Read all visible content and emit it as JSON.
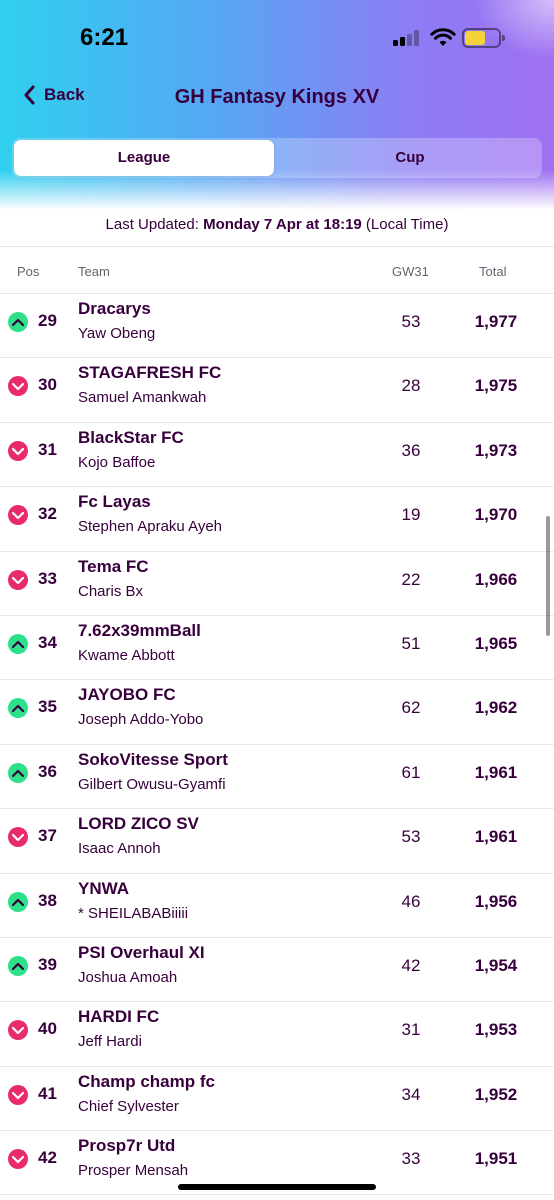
{
  "status_bar": {
    "time": "6:21"
  },
  "nav": {
    "back_label": "Back",
    "title": "GH Fantasy Kings XV"
  },
  "tabs": [
    {
      "label": "League"
    },
    {
      "label": "Cup"
    }
  ],
  "updated": {
    "prefix": "Last Updated: ",
    "date": "Monday 7 Apr at 18:19",
    "suffix": " (Local Time)"
  },
  "table": {
    "headers": {
      "pos": "Pos",
      "team": "Team",
      "gw": "GW31",
      "total": "Total"
    },
    "rows": [
      {
        "movement": "up",
        "pos": "29",
        "team": "Dracarys",
        "manager": "Yaw Obeng",
        "gw": "53",
        "total": "1,977"
      },
      {
        "movement": "down",
        "pos": "30",
        "team": "STAGAFRESH FC",
        "manager": "Samuel Amankwah",
        "gw": "28",
        "total": "1,975"
      },
      {
        "movement": "down",
        "pos": "31",
        "team": "BlackStar FC",
        "manager": "Kojo Baffoe",
        "gw": "36",
        "total": "1,973"
      },
      {
        "movement": "down",
        "pos": "32",
        "team": "Fc Layas",
        "manager": "Stephen Apraku Ayeh",
        "gw": "19",
        "total": "1,970"
      },
      {
        "movement": "down",
        "pos": "33",
        "team": "Tema FC",
        "manager": "Charis Bx",
        "gw": "22",
        "total": "1,966"
      },
      {
        "movement": "up",
        "pos": "34",
        "team": "7.62x39mmBall",
        "manager": "Kwame Abbott",
        "gw": "51",
        "total": "1,965"
      },
      {
        "movement": "up",
        "pos": "35",
        "team": "JAYOBO FC",
        "manager": "Joseph Addo-Yobo",
        "gw": "62",
        "total": "1,962"
      },
      {
        "movement": "up",
        "pos": "36",
        "team": "SokoVitesse Sport",
        "manager": "Gilbert Owusu-Gyamfi",
        "gw": "61",
        "total": "1,961"
      },
      {
        "movement": "down",
        "pos": "37",
        "team": "LORD ZICO SV",
        "manager": "Isaac Annoh",
        "gw": "53",
        "total": "1,961"
      },
      {
        "movement": "up",
        "pos": "38",
        "team": "YNWA",
        "manager": "* SHEILABABiiiii",
        "gw": "46",
        "total": "1,956"
      },
      {
        "movement": "up",
        "pos": "39",
        "team": "PSI Overhaul XI",
        "manager": "Joshua Amoah",
        "gw": "42",
        "total": "1,954"
      },
      {
        "movement": "down",
        "pos": "40",
        "team": "HARDI FC",
        "manager": "Jeff Hardi",
        "gw": "31",
        "total": "1,953"
      },
      {
        "movement": "down",
        "pos": "41",
        "team": "Champ champ fc",
        "manager": "Chief Sylvester",
        "gw": "34",
        "total": "1,952"
      },
      {
        "movement": "down",
        "pos": "42",
        "team": "Prosp7r Utd",
        "manager": "Prosper Mensah",
        "gw": "33",
        "total": "1,951"
      }
    ]
  },
  "colors": {
    "brand": "#37003c",
    "up": "#2ee08a",
    "down": "#e92b6e"
  }
}
